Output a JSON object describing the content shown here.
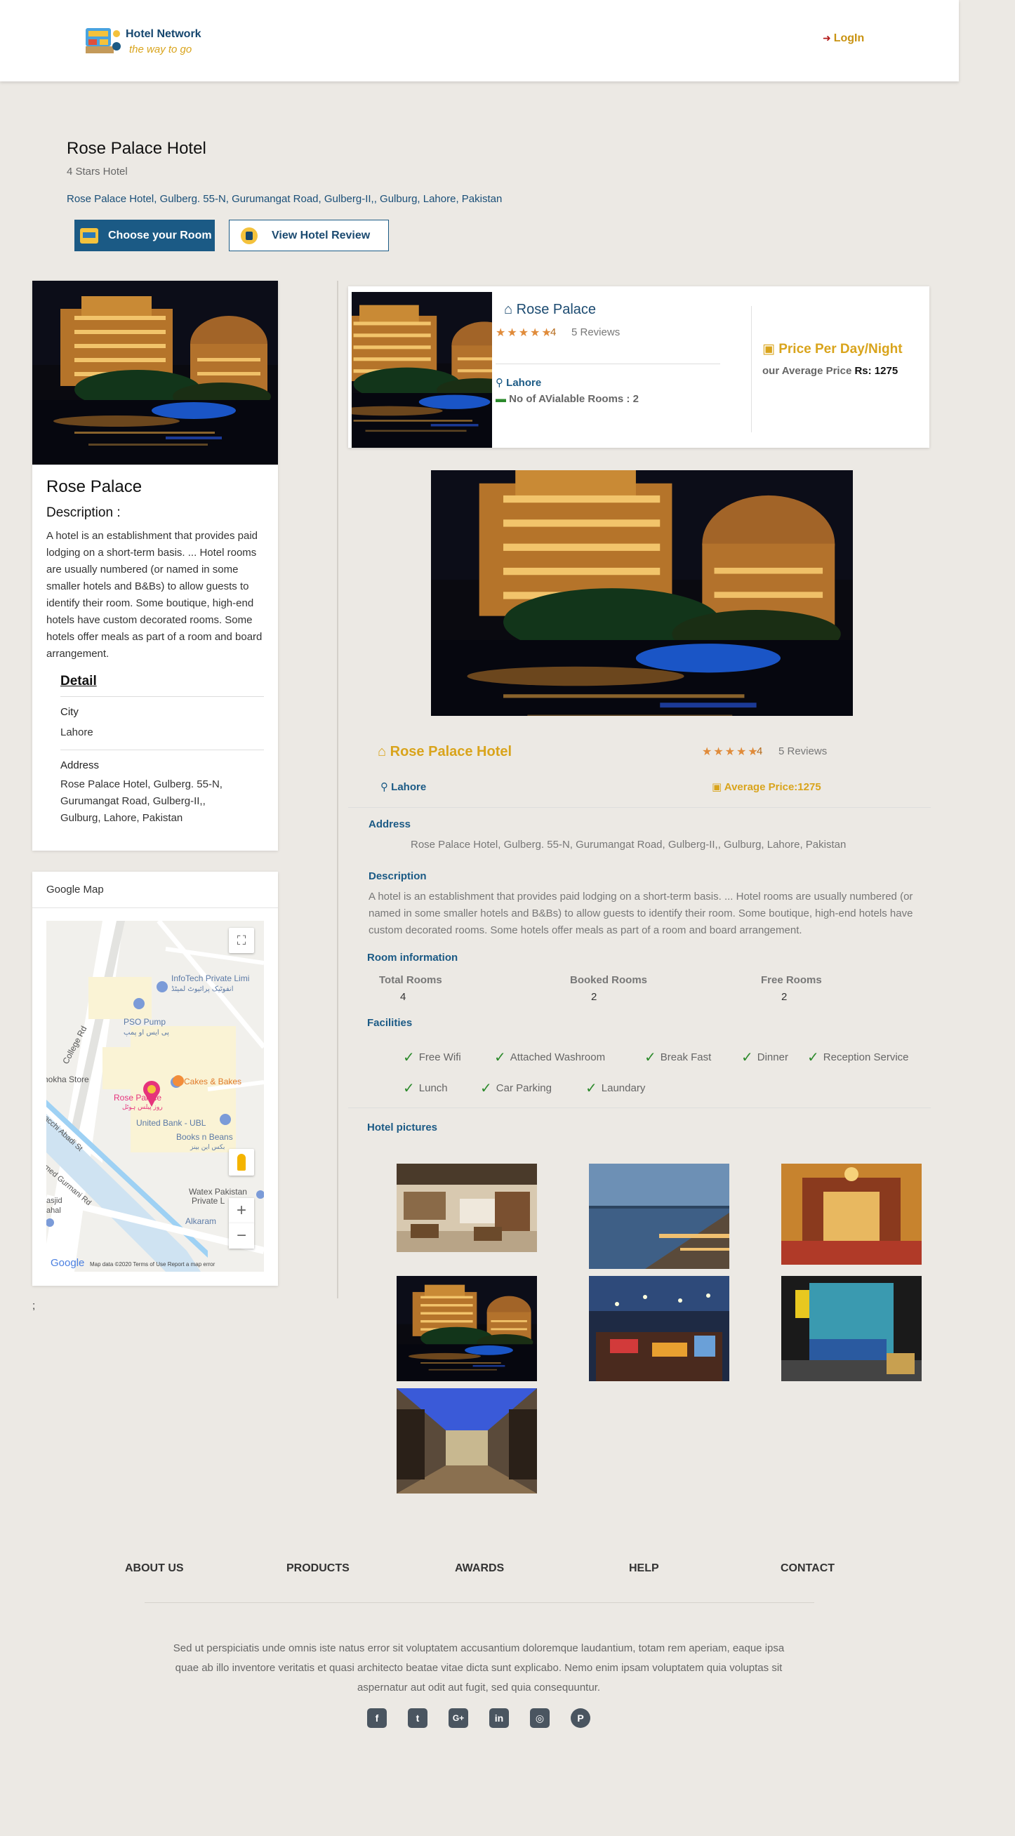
{
  "header": {
    "brand_name": "Hotel Network",
    "brand_tagline": "the way to go",
    "login_label": "LogIn"
  },
  "hotel": {
    "title": "Rose Palace Hotel",
    "stars_label": "4 Stars Hotel",
    "address": "Rose Palace Hotel, Gulberg. 55-N, Gurumangat Road, Gulberg-II,, Gulburg, Lahore, Pakistan",
    "choose_room_label": "Choose your Room",
    "view_review_label": "View Hotel Review"
  },
  "left_card": {
    "name": "Rose Palace",
    "description_heading": "Description :",
    "description": "A hotel is an establishment that provides paid lodging on a short-term basis. ... Hotel rooms are usually numbered (or named in some smaller hotels and B&Bs) to allow guests to identify their room. Some boutique, high-end hotels have custom decorated rooms. Some hotels offer meals as part of a room and board arrangement.",
    "detail_heading": "Detail",
    "city_label": "City",
    "city_value": "Lahore",
    "address_label": "Address",
    "address_value": "Rose Palace Hotel, Gulberg. 55-N, Gurumangat Road, Gulberg-II,, Gulburg, Lahore, Pakistan"
  },
  "map_card": {
    "heading": "Google Map",
    "labels": {
      "infotech": "InfoTech Private Limi",
      "infotech_urdu": "انفوٹیک پرائیوٹ لمیٹڈ",
      "pso": "PSO Pump",
      "pso_urdu": "پی ایس او پمپ",
      "college_rd": "College Rd",
      "okha": "hokha Store",
      "cakes": "Cakes & Bakes",
      "rose": "Rose Palace",
      "rose_urdu": "روز پیلس ہوٹل",
      "ubl": "United Bank - UBL",
      "books": "Books n Beans",
      "books_urdu": "بکس این بینز",
      "abadi": "acchi Abadi St",
      "gurmani": "med Gurmani Rd",
      "masjid": "asjid",
      "jahal": "ahal",
      "watex": "Watex Pakistan",
      "watex2": "Private L",
      "alkaram": "Alkaram",
      "google": "Google",
      "footer": "Map data ©2020    Terms of Use    Report a map error"
    }
  },
  "semicolon": ";",
  "summary": {
    "name": "Rose Palace",
    "stars": "★★★★★",
    "rating": "4",
    "reviews": "5 Reviews",
    "city": "Lahore",
    "rooms_available": "No of AVialable Rooms : 2",
    "price_heading": "Price Per Day/Night",
    "price_label": "our Average Price",
    "price_value": "Rs: 1275"
  },
  "detail": {
    "name": "Rose Palace Hotel",
    "stars": "★★★★★",
    "rating": "4",
    "reviews": "5 Reviews",
    "city": "Lahore",
    "average_price": "Average Price:1275",
    "address_heading": "Address",
    "address": "Rose Palace Hotel, Gulberg. 55-N, Gurumangat Road, Gulberg-II,, Gulburg, Lahore, Pakistan",
    "description_heading": "Description",
    "description": "A hotel is an establishment that provides paid lodging on a short-term basis. ... Hotel rooms are usually numbered (or named in some smaller hotels and B&Bs) to allow guests to identify their room. Some boutique, high-end hotels have custom decorated rooms. Some hotels offer meals as part of a room and board arrangement.",
    "room_info_heading": "Room information",
    "rooms": {
      "total_label": "Total Rooms",
      "total": "4",
      "booked_label": "Booked Rooms",
      "booked": "2",
      "free_label": "Free Rooms",
      "free": "2"
    },
    "facilities_heading": "Facilities",
    "facilities": [
      "Free Wifi",
      "Attached Washroom",
      "Break Fast",
      "Dinner",
      "Reception Service",
      "Lunch",
      "Car Parking",
      "Laundary"
    ],
    "pictures_heading": "Hotel pictures"
  },
  "footer": {
    "links": [
      "ABOUT US",
      "PRODUCTS",
      "AWARDS",
      "HELP",
      "CONTACT"
    ],
    "text": "Sed ut perspiciatis unde omnis iste natus error sit voluptatem accusantium doloremque laudantium, totam rem aperiam, eaque ipsa quae ab illo inventore veritatis et quasi architecto beatae vitae dicta sunt explicabo. Nemo enim ipsam voluptatem quia voluptas sit aspernatur aut odit aut fugit, sed quia consequuntur.",
    "social": [
      {
        "icon": "facebook-icon",
        "glyph": "f"
      },
      {
        "icon": "twitter-icon",
        "glyph": "t"
      },
      {
        "icon": "google-plus-icon",
        "glyph": "G+"
      },
      {
        "icon": "linkedin-icon",
        "glyph": "in"
      },
      {
        "icon": "instagram-icon",
        "glyph": "◎"
      },
      {
        "icon": "pinterest-icon",
        "glyph": "P"
      }
    ]
  },
  "colors": {
    "navy": "#1b5a85",
    "gold": "#d9a41c",
    "star": "#e08b3a",
    "check": "#2c8a2c",
    "background": "#ece9e4"
  }
}
